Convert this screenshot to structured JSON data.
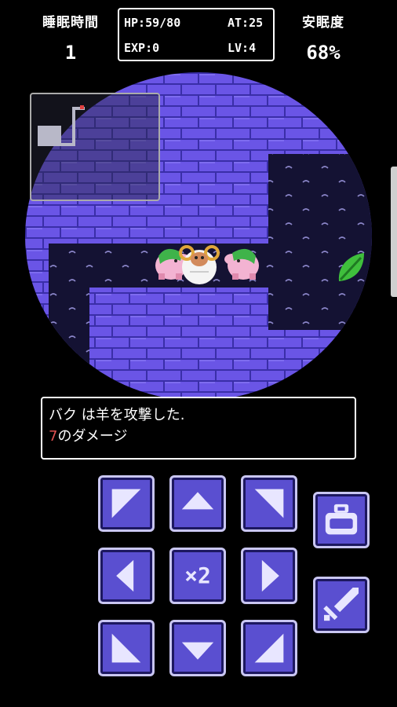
{
  "hud": {
    "sleep_time_label": "睡眠時間",
    "sleep_time_value": "1",
    "comfort_label": "安眠度",
    "comfort_value": "68%"
  },
  "stats": {
    "hp": "HP:59/80",
    "at": "AT:25",
    "exp": "EXP:0",
    "lv": "LV:4"
  },
  "message": {
    "line1": "バク は羊を攻撃した.",
    "damage_value": "7",
    "line2_suffix": "のダメージ"
  },
  "controls": {
    "multiplier_label": "×2"
  },
  "colors": {
    "brick": "#6a55e6",
    "mortar": "#3a2ea8",
    "floor": "#141233",
    "button_face": "#5a4fd0",
    "damage_text": "#e05050"
  },
  "icons": [
    "arrow-up-left-icon",
    "arrow-up-icon",
    "arrow-up-right-icon",
    "arrow-left-icon",
    "arrow-right-icon",
    "arrow-down-left-icon",
    "arrow-down-icon",
    "arrow-down-right-icon",
    "bag-icon",
    "sword-icon",
    "leaf-icon"
  ]
}
